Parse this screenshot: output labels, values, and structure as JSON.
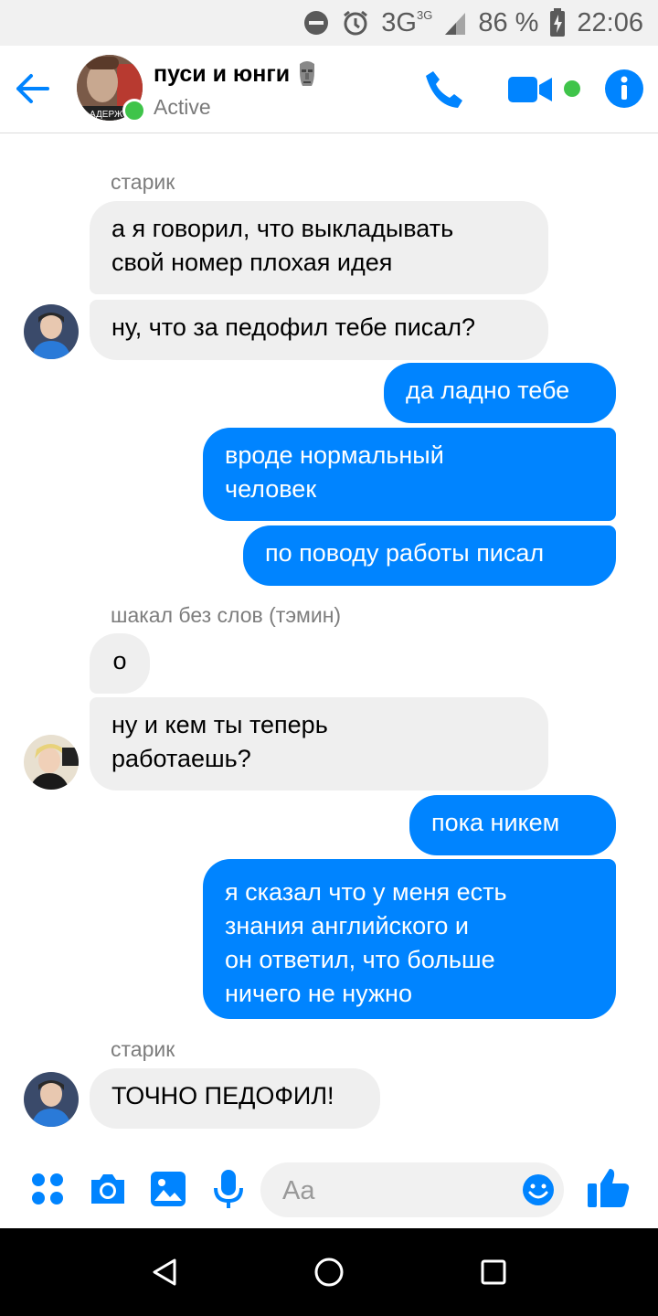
{
  "status_bar": {
    "network": "3G",
    "network_sup": "3G",
    "battery": "86 %",
    "time": "22:06"
  },
  "header": {
    "title": "пуси и юнги",
    "status": "Active",
    "avatar_text": "АДЕРЖ",
    "accent_color": "#0084ff",
    "online_color": "#3fc44a"
  },
  "messages": [
    {
      "sender": "старик"
    },
    {
      "direction": "in",
      "text": "а я говорил, что выкладывать\nсвой номер плохая идея"
    },
    {
      "direction": "in",
      "text": "ну, что за педофил тебе писал?"
    },
    {
      "direction": "out",
      "text": "да ладно тебе"
    },
    {
      "direction": "out",
      "text": "вроде нормальный\nчеловек"
    },
    {
      "direction": "out",
      "text": "по поводу работы писал"
    },
    {
      "sender": "шакал без слов (тэмин)"
    },
    {
      "direction": "in",
      "text": "о"
    },
    {
      "direction": "in",
      "text": "ну и кем ты теперь\nработаешь?"
    },
    {
      "direction": "out",
      "text": "пока никем"
    },
    {
      "direction": "out",
      "text": "я сказал что у меня есть\nзнания английского и\nон ответил, что больше\nничего не нужно"
    },
    {
      "sender": "старик"
    },
    {
      "direction": "in",
      "text": "ТОЧНО ПЕДОФИЛ!"
    }
  ],
  "composer": {
    "placeholder": "Aa",
    "icons": [
      "apps-icon",
      "camera-icon",
      "gallery-icon",
      "microphone-icon",
      "emoji-icon",
      "thumbs-up-icon"
    ]
  },
  "nav": {
    "icons": [
      "back-triangle-icon",
      "home-circle-icon",
      "recents-square-icon"
    ]
  }
}
